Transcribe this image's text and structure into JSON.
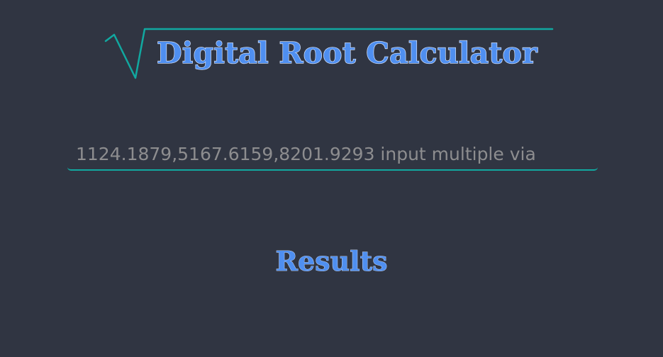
{
  "header": {
    "title": "Digital Root Calculator",
    "symbol": "radical-icon"
  },
  "input": {
    "placeholder": "1124.1879,5167.6159,8201.9293 input multiple via",
    "value": ""
  },
  "results": {
    "heading": "Results"
  },
  "colors": {
    "background": "#303542",
    "accent": "#11a8a0",
    "title_fill": "#4f8ff0",
    "title_outline": "#dfeaff",
    "placeholder": "#8d8d8f"
  }
}
